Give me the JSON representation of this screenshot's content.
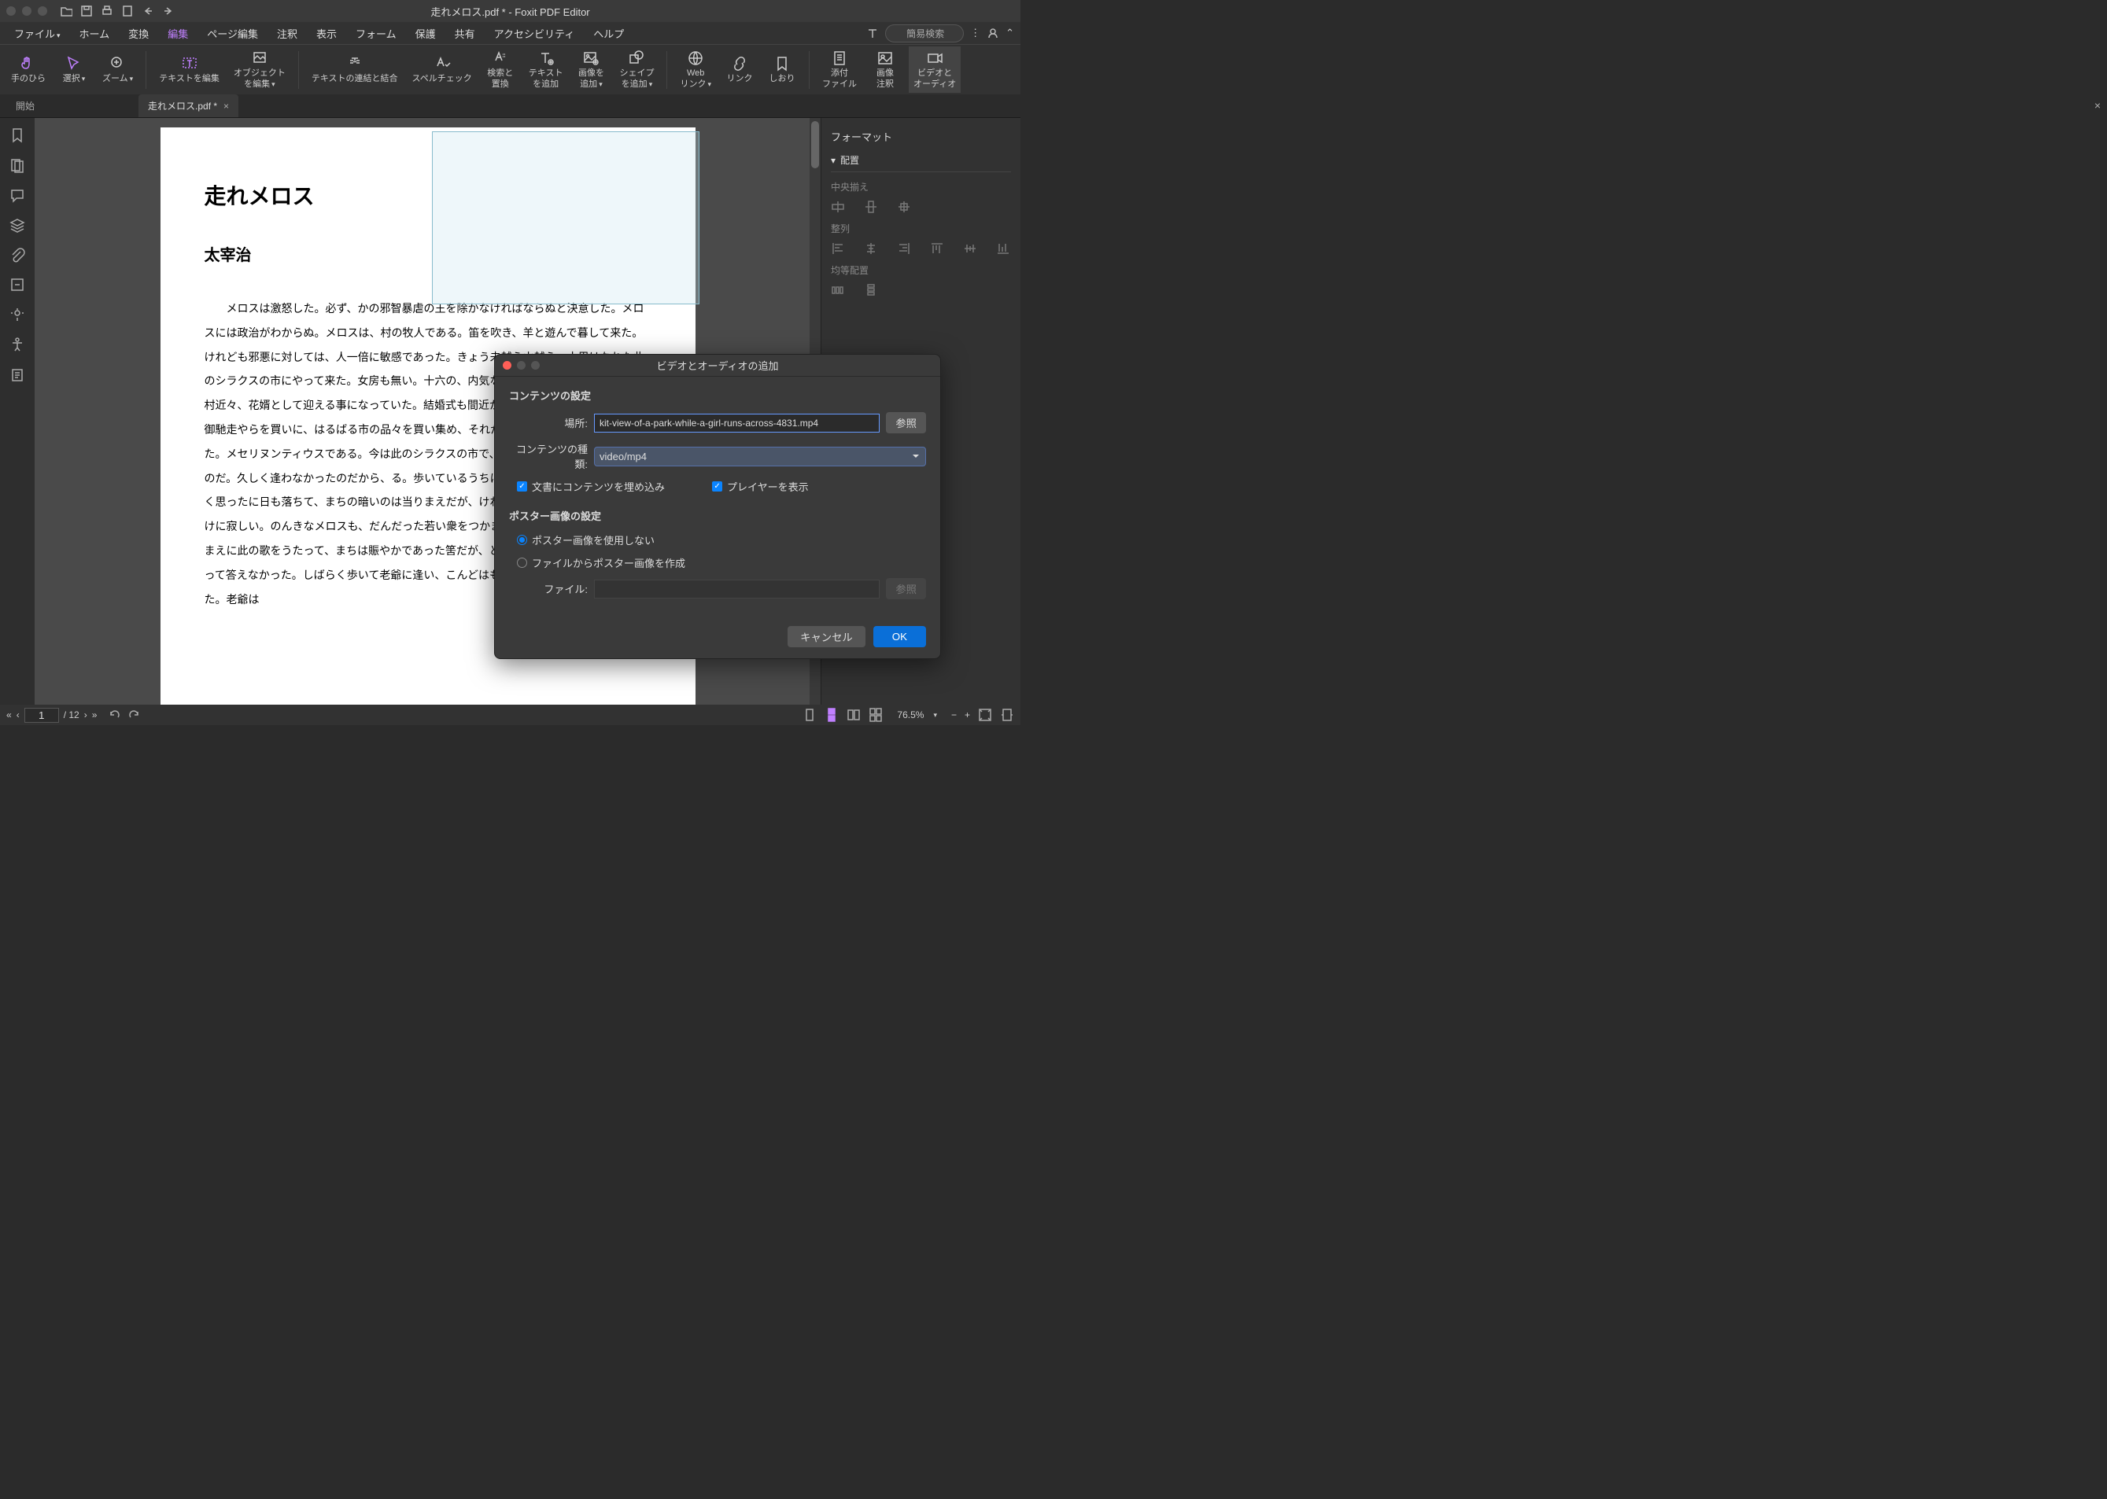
{
  "titlebar": {
    "title": "走れメロス.pdf * - Foxit PDF Editor"
  },
  "menubar": {
    "items": [
      "ファイル",
      "ホーム",
      "変換",
      "編集",
      "ページ編集",
      "注釈",
      "表示",
      "フォーム",
      "保護",
      "共有",
      "アクセシビリティ",
      "ヘルプ"
    ],
    "active_index": 3,
    "search_placeholder": "簡易検索"
  },
  "ribbon": {
    "buttons": [
      {
        "label": "手のひら",
        "name": "hand-tool"
      },
      {
        "label": "選択",
        "name": "select-tool",
        "caret": true
      },
      {
        "label": "ズーム",
        "name": "zoom-tool",
        "caret": true
      },
      {
        "sep": true
      },
      {
        "label": "テキストを編集",
        "name": "edit-text",
        "purple": true
      },
      {
        "label": "オブジェクト\nを編集",
        "name": "edit-object",
        "caret": true
      },
      {
        "sep": true
      },
      {
        "label": "テキストの連結と結合",
        "name": "link-join-text"
      },
      {
        "label": "スペルチェック",
        "name": "spellcheck"
      },
      {
        "label": "検索と\n置換",
        "name": "search-replace"
      },
      {
        "label": "テキスト\nを追加",
        "name": "add-text"
      },
      {
        "label": "画像を\n追加",
        "name": "add-image",
        "caret": true
      },
      {
        "label": "シェイプ\nを追加",
        "name": "add-shape",
        "caret": true
      },
      {
        "sep": true
      },
      {
        "label": "Web\nリンク",
        "name": "web-link",
        "caret": true
      },
      {
        "label": "リンク",
        "name": "link"
      },
      {
        "label": "しおり",
        "name": "bookmark"
      },
      {
        "sep": true
      },
      {
        "label": "添付\nファイル",
        "name": "attachment"
      },
      {
        "label": "画像\n注釈",
        "name": "image-annotation"
      },
      {
        "label": "ビデオと\nオーディオ",
        "name": "video-audio",
        "active": true
      }
    ]
  },
  "tabs": {
    "start": "開始",
    "doc": "走れメロス.pdf *"
  },
  "rightpanel": {
    "title": "フォーマット",
    "section": "配置",
    "labels": {
      "center": "中央揃え",
      "align": "整列",
      "distribute": "均等配置"
    }
  },
  "document": {
    "title": "走れメロス",
    "author": "太宰治",
    "body": "　メロスは激怒した。必ず、かの邪智暴虐の王を除かなければならぬと決意した。メロスには政治がわからぬ。メロスは、村の牧人である。笛を吹き、羊と遊んで暮して来た。けれども邪悪に対しては、人一倍に敏感であった。きょう未越え山越え、十里はなれた此のシラクスの市にやって来た。女房も無い。十六の、内気な妹と二人暮しだ。この妹は、村近々、花婿として迎える事になっていた。結婚式も間近かなえ、花嫁の衣裳やら祝宴の御馳走やらを買いに、はるばる市の品々を買い集め、それから都の大路をぶらぶら歩いた。メセリヌンティウスである。今は此のシラクスの市で、石工をら訪ねてみるつもりなのだ。久しく逢わなかったのだから、る。歩いているうちにメロスは、まちの様子を怪しく思ったに日も落ちて、まちの暗いのは当りまえだが、けれども、な無く、市全体が、やけに寂しい。のんきなメロスも、だんだった若い衆をつかまえて、何かあったのか、二年まえに此の歌をうたって、まちは賑やかであった筈だが、と質問した。若い衆は、首を振って答えなかった。しばらく歩いて老爺に逢い、こんどはもっと、語勢を強くして質問した。老爺は"
  },
  "dialog": {
    "title": "ビデオとオーディオの追加",
    "content_section": "コンテンツの設定",
    "location_label": "場所:",
    "location_value": "kit-view-of-a-park-while-a-girl-runs-across-4831.mp4",
    "browse": "参照",
    "type_label": "コンテンツの種類:",
    "type_value": "video/mp4",
    "embed": "文書にコンテンツを埋め込み",
    "show_player": "プレイヤーを表示",
    "poster_section": "ポスター画像の設定",
    "no_poster": "ポスター画像を使用しない",
    "poster_from_file": "ファイルからポスター画像を作成",
    "file_label": "ファイル:",
    "cancel": "キャンセル",
    "ok": "OK"
  },
  "statusbar": {
    "page": "1",
    "total": "/ 12",
    "zoom": "76.5%"
  }
}
